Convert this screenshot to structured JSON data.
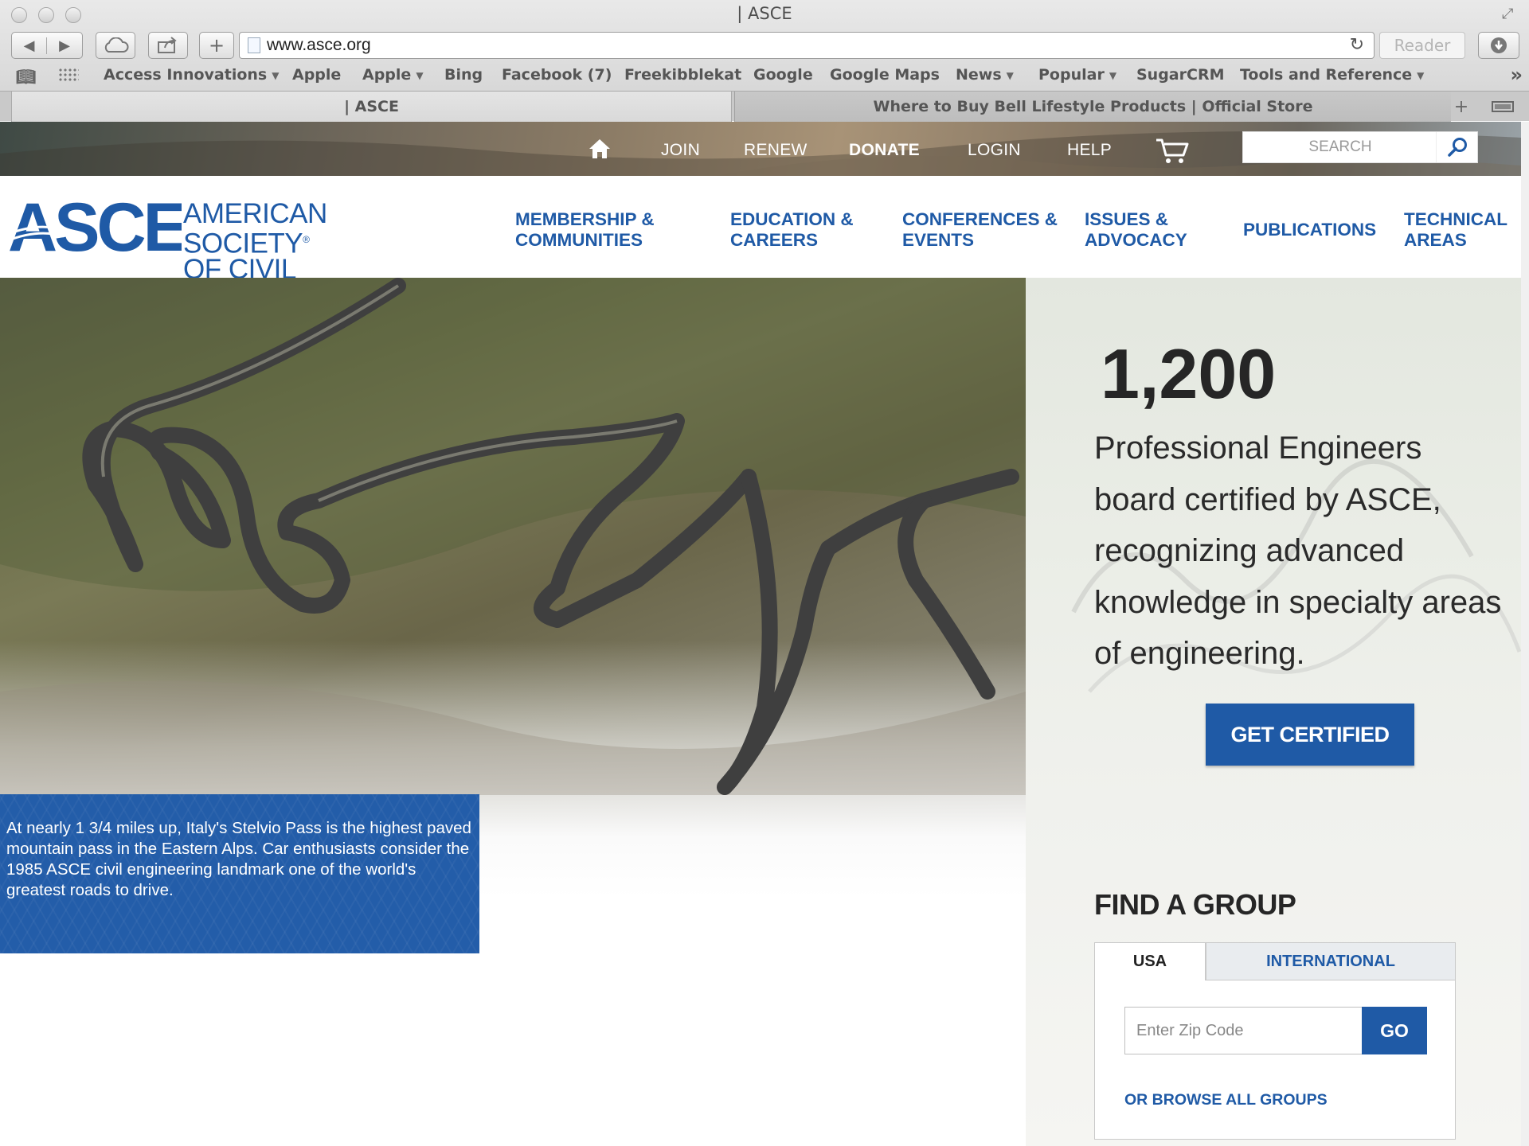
{
  "window": {
    "title": "| ASCE"
  },
  "toolbar": {
    "url": "www.asce.org",
    "reader_label": "Reader"
  },
  "bookmarks": [
    {
      "label": "Access Innovations",
      "menu": true
    },
    {
      "label": "Apple",
      "menu": false
    },
    {
      "label": "Apple",
      "menu": true
    },
    {
      "label": "Bing",
      "menu": false
    },
    {
      "label": "Facebook (7)",
      "menu": false
    },
    {
      "label": "Freekibblekat",
      "menu": false
    },
    {
      "label": "Google",
      "menu": false
    },
    {
      "label": "Google Maps",
      "menu": false
    },
    {
      "label": "News",
      "menu": true
    },
    {
      "label": "Popular",
      "menu": true
    },
    {
      "label": "SugarCRM",
      "menu": false
    },
    {
      "label": "Tools and Reference",
      "menu": true
    }
  ],
  "tabs": [
    {
      "label": "| ASCE"
    },
    {
      "label": "Where to Buy Bell Lifestyle Products | Official Store"
    }
  ],
  "utility": {
    "join": "JOIN",
    "renew": "RENEW",
    "donate": "DONATE",
    "login": "LOGIN",
    "help": "HELP",
    "search_placeholder": "SEARCH"
  },
  "logo": {
    "acronym": "ASCE",
    "line1": "AMERICAN SOCIETY",
    "reg": "®",
    "line2": "OF CIVIL ENGINEERS"
  },
  "nav": [
    {
      "line1": "MEMBERSHIP &",
      "line2": "COMMUNITIES"
    },
    {
      "line1": "EDUCATION &",
      "line2": "CAREERS"
    },
    {
      "line1": "CONFERENCES &",
      "line2": "EVENTS"
    },
    {
      "line1": "ISSUES &",
      "line2": "ADVOCACY"
    },
    {
      "line1": "PUBLICATIONS",
      "line2": ""
    },
    {
      "line1": "TECHNICAL",
      "line2": "AREAS"
    }
  ],
  "hero": {
    "caption": "At nearly 1 3/4 miles up, Italy's Stelvio Pass is the highest paved mountain pass in the Eastern Alps. Car enthusiasts consider the 1985 ASCE civil engineering landmark one of the world's greatest roads to drive.",
    "stat_number": "1,200",
    "stat_text": "Professional Engineers board certified by ASCE, recognizing advanced knowledge in specialty areas of engineering.",
    "cta": "GET CERTIFIED"
  },
  "find_group": {
    "title": "FIND A GROUP",
    "tab_usa": "USA",
    "tab_international": "INTERNATIONAL",
    "zip_placeholder": "Enter Zip Code",
    "go": "GO",
    "browse": "OR BROWSE ALL GROUPS"
  },
  "colors": {
    "brand_blue": "#1f5aa6",
    "caption_blue": "#235da9"
  }
}
